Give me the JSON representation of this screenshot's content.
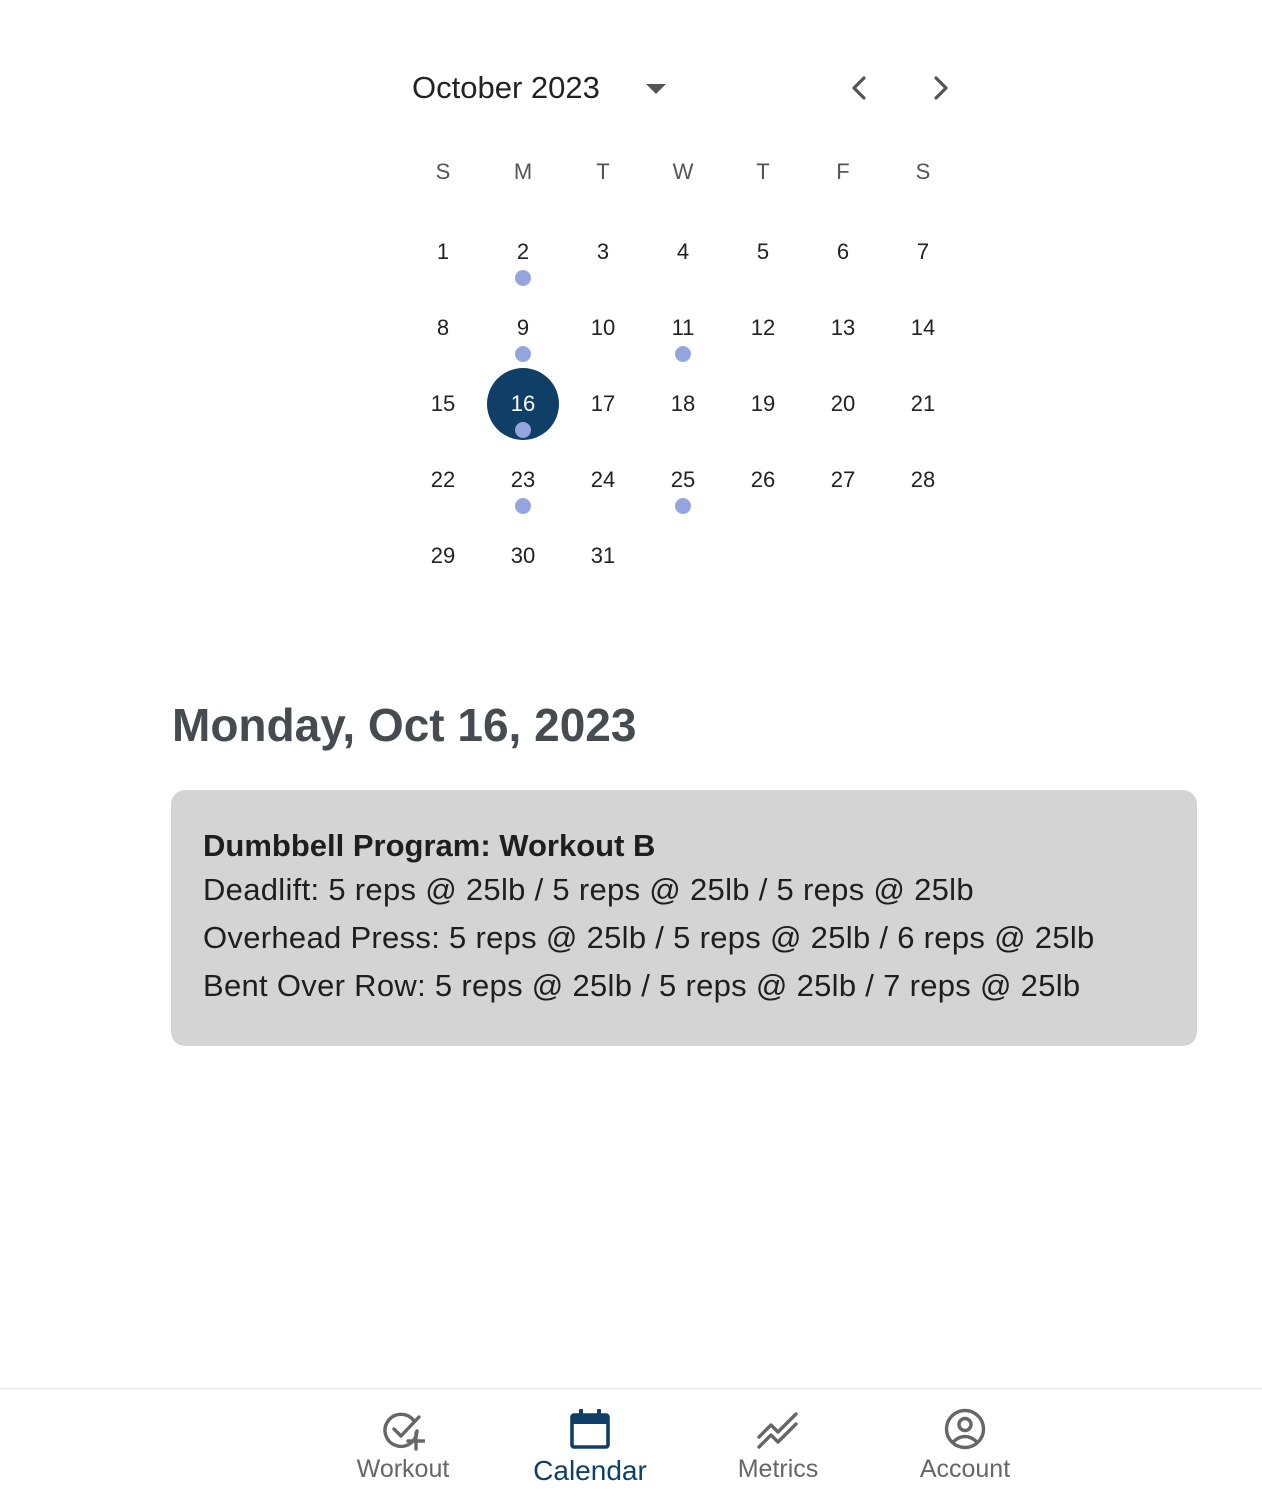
{
  "calendar": {
    "month_label": "October 2023",
    "weekdays": [
      "S",
      "M",
      "T",
      "W",
      "T",
      "F",
      "S"
    ],
    "weeks": [
      [
        {
          "day": "1",
          "workout": false,
          "selected": false
        },
        {
          "day": "2",
          "workout": true,
          "selected": false
        },
        {
          "day": "3",
          "workout": false,
          "selected": false
        },
        {
          "day": "4",
          "workout": false,
          "selected": false
        },
        {
          "day": "5",
          "workout": false,
          "selected": false
        },
        {
          "day": "6",
          "workout": false,
          "selected": false
        },
        {
          "day": "7",
          "workout": false,
          "selected": false
        }
      ],
      [
        {
          "day": "8",
          "workout": false,
          "selected": false
        },
        {
          "day": "9",
          "workout": true,
          "selected": false
        },
        {
          "day": "10",
          "workout": false,
          "selected": false
        },
        {
          "day": "11",
          "workout": true,
          "selected": false
        },
        {
          "day": "12",
          "workout": false,
          "selected": false
        },
        {
          "day": "13",
          "workout": false,
          "selected": false
        },
        {
          "day": "14",
          "workout": false,
          "selected": false
        }
      ],
      [
        {
          "day": "15",
          "workout": false,
          "selected": false
        },
        {
          "day": "16",
          "workout": true,
          "selected": true
        },
        {
          "day": "17",
          "workout": false,
          "selected": false
        },
        {
          "day": "18",
          "workout": false,
          "selected": false
        },
        {
          "day": "19",
          "workout": false,
          "selected": false
        },
        {
          "day": "20",
          "workout": false,
          "selected": false
        },
        {
          "day": "21",
          "workout": false,
          "selected": false
        }
      ],
      [
        {
          "day": "22",
          "workout": false,
          "selected": false
        },
        {
          "day": "23",
          "workout": true,
          "selected": false
        },
        {
          "day": "24",
          "workout": false,
          "selected": false
        },
        {
          "day": "25",
          "workout": true,
          "selected": false
        },
        {
          "day": "26",
          "workout": false,
          "selected": false
        },
        {
          "day": "27",
          "workout": false,
          "selected": false
        },
        {
          "day": "28",
          "workout": false,
          "selected": false
        }
      ],
      [
        {
          "day": "29",
          "workout": false,
          "selected": false
        },
        {
          "day": "30",
          "workout": false,
          "selected": false
        },
        {
          "day": "31",
          "workout": false,
          "selected": false
        },
        null,
        null,
        null,
        null
      ]
    ],
    "icons": {
      "month_dropdown": "caret-down-icon",
      "previous": "chevron-left-icon",
      "next": "chevron-right-icon"
    }
  },
  "selected_date": {
    "title": "Monday, Oct 16, 2023"
  },
  "workout": {
    "title": "Dumbbell Program: Workout B",
    "exercises": [
      "Deadlift: 5 reps @ 25lb / 5 reps @ 25lb / 5 reps @ 25lb",
      "Overhead Press: 5 reps @ 25lb / 5 reps @ 25lb / 6 reps @ 25lb",
      "Bent Over Row: 5 reps @ 25lb / 5 reps @ 25lb / 7 reps @ 25lb"
    ]
  },
  "bottom_nav": {
    "items": [
      {
        "label": "Workout",
        "icon": "check-circle-plus-icon",
        "active": false
      },
      {
        "label": "Calendar",
        "icon": "calendar-icon",
        "active": true
      },
      {
        "label": "Metrics",
        "icon": "trend-lines-icon",
        "active": false
      },
      {
        "label": "Account",
        "icon": "account-circle-icon",
        "active": false
      }
    ]
  },
  "colors": {
    "accent": "#0f3f66",
    "workout_dot": "#94a6dd",
    "card_background": "#d4d4d4",
    "date_title": "#464b4f",
    "inactive_nav": "#666666"
  }
}
